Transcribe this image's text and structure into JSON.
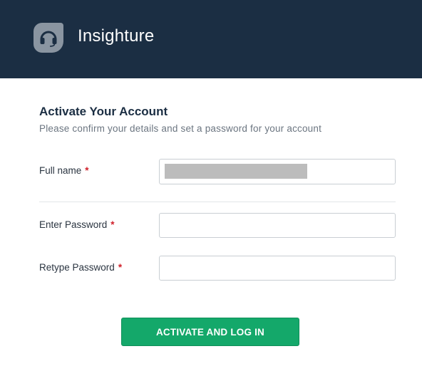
{
  "header": {
    "brand_name": "Insighture",
    "logo_icon": "headset-icon",
    "background_color": "#1b2e43"
  },
  "form": {
    "title": "Activate Your Account",
    "subtitle": "Please confirm your details and set a password for your account",
    "required_marker": "*",
    "fields": {
      "full_name": {
        "label": "Full name",
        "value": "",
        "redacted": true
      },
      "password": {
        "label": "Enter Password",
        "value": ""
      },
      "retype_password": {
        "label": "Retype Password",
        "value": ""
      }
    },
    "submit_label": "ACTIVATE AND LOG IN",
    "submit_color": "#14a86a"
  }
}
